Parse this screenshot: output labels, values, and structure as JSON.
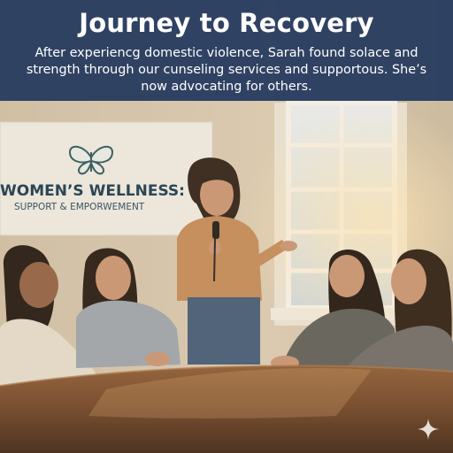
{
  "header": {
    "title": "Journey to Recovery",
    "story": "After experiencg domestic violence, Sarah found solace and strength through our cunseling services and supportous. She’s now advocating for others."
  },
  "banner": {
    "line1": "WOMEN’S WELLNESS:",
    "line2": "SUPPORT & EMPORWEMENT",
    "logo_icon": "butterfly-icon"
  },
  "colors": {
    "header_bg": "#24385c",
    "banner_text": "#2a4656"
  },
  "watermark_icon": "sparkle-icon"
}
